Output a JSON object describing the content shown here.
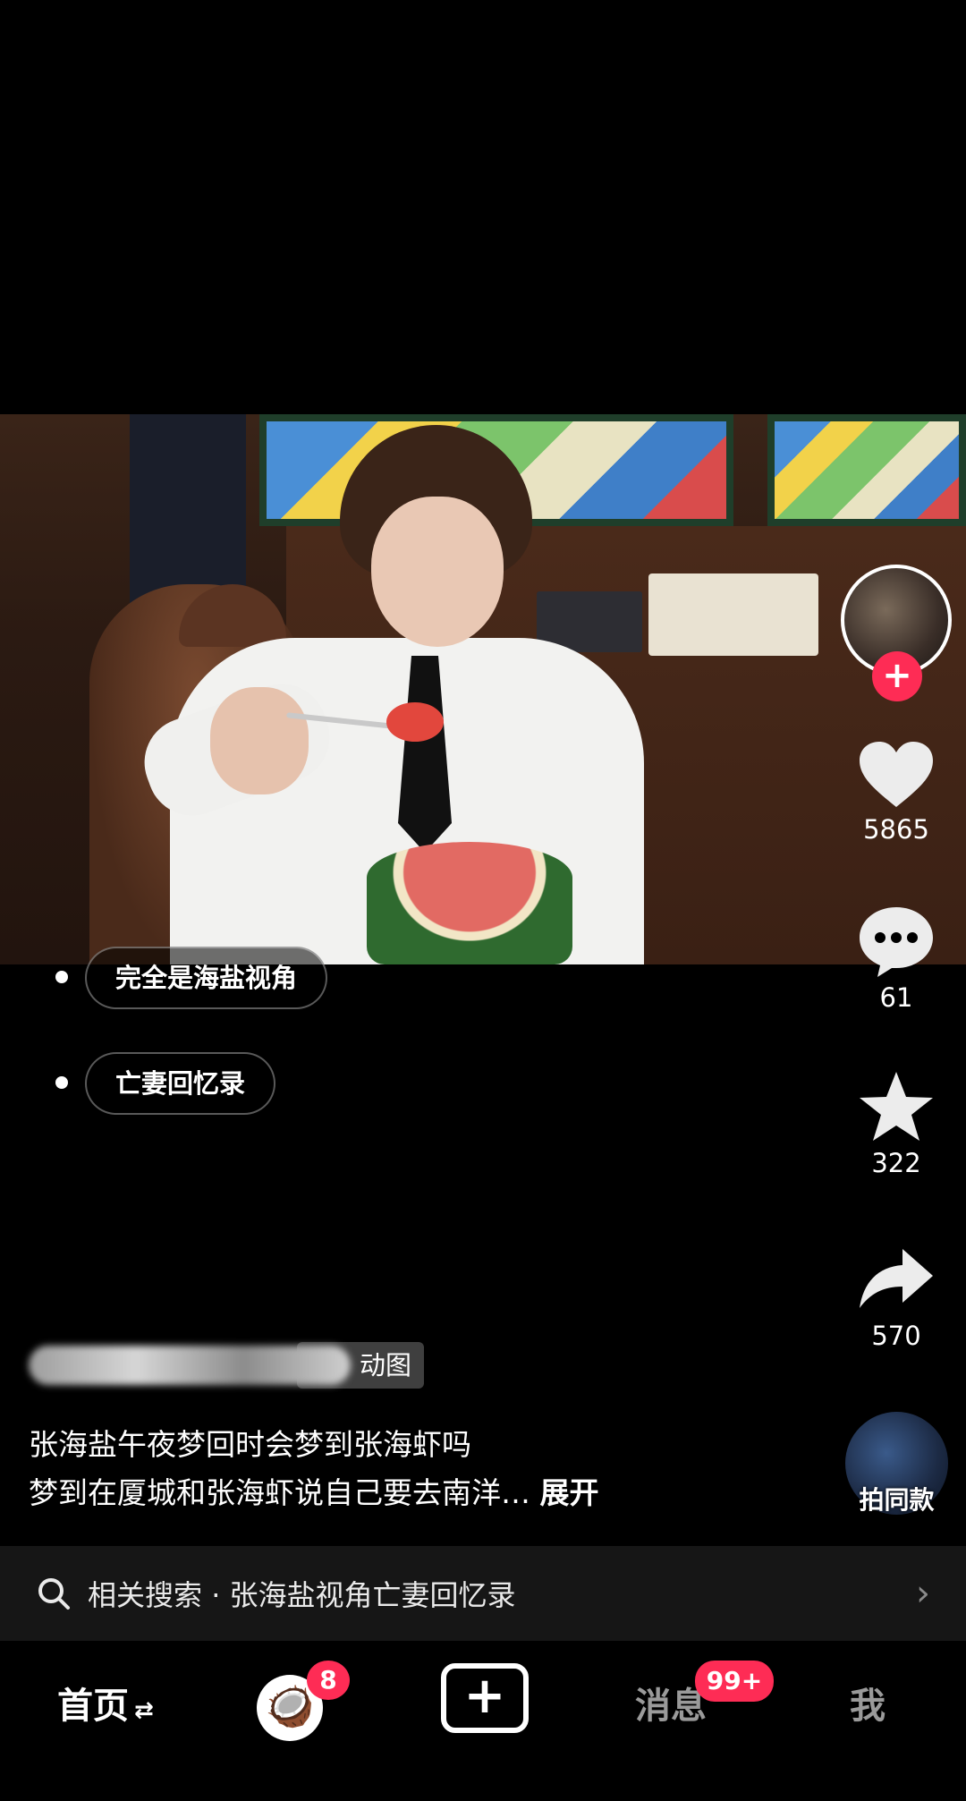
{
  "tags": [
    "完全是海盐视角",
    "亡妻回忆录"
  ],
  "rail": {
    "likes": "5865",
    "comments": "61",
    "favorites": "322",
    "shares": "570",
    "same_style": "拍同款"
  },
  "author": {
    "chip_label": "图",
    "chip_prefix": "动"
  },
  "caption": {
    "line1": "张海盐午夜梦回时会梦到张海虾吗",
    "line2": "梦到在厦城和张海虾说自己要去南洋…",
    "expand": "展开"
  },
  "related_search": {
    "prefix": "相关搜索",
    "separator": "·",
    "query": "张海盐视角亡妻回忆录"
  },
  "nav": {
    "home": "首页",
    "home_swap": "⇄",
    "coconut_badge": "8",
    "plus": "+",
    "messages": "消息",
    "messages_badge": "99+",
    "me": "我"
  },
  "colors": {
    "accent": "#fe2c55",
    "background": "#000000"
  }
}
